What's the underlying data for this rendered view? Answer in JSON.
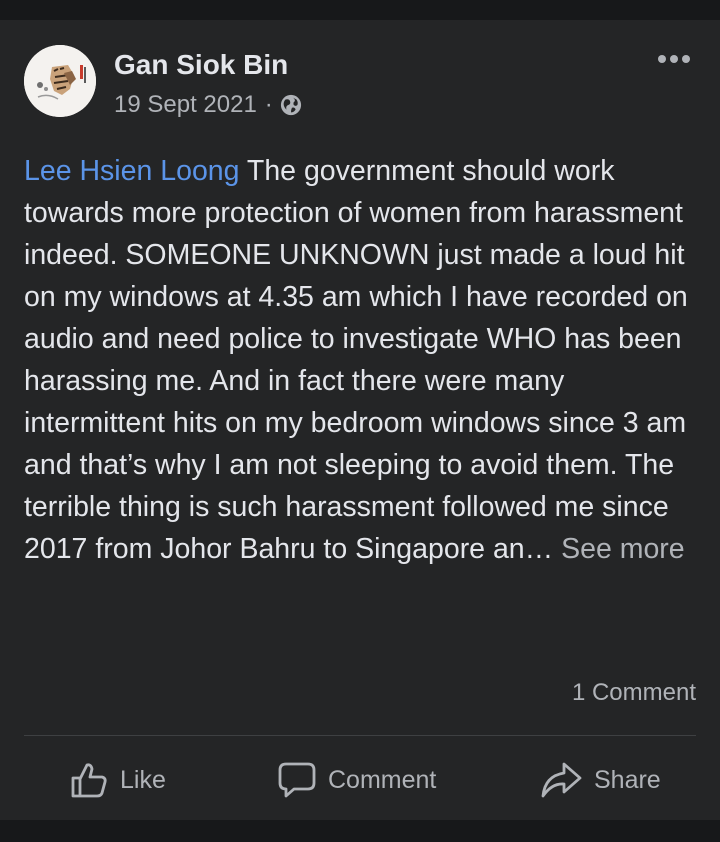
{
  "post": {
    "author": "Gan Siok Bin",
    "date": "19 Sept 2021",
    "separator": "·",
    "privacy_icon": "globe-icon",
    "options_icon": "more-options-icon",
    "mention": "Lee Hsien Loong",
    "body": " The government should work towards more protection of women from harassment indeed. SOMEONE UNKNOWN just made a loud hit on my windows at 4.35 am which I have recorded on audio and need police to investigate WHO has been harassing me. And in fact there were many intermittent hits on my bedroom windows since 3 am and that’s why I am not sleeping to avoid them. The  terrible thing is such harassment followed me since 2017 from Johor Bahru to Singapore an…",
    "see_more": " See more",
    "comment_count": "1 Comment"
  },
  "actions": {
    "like": "Like",
    "comment": "Comment",
    "share": "Share"
  },
  "colors": {
    "background": "#17181a",
    "card": "#242526",
    "primary_text": "#e4e6eb",
    "secondary_text": "#b0b3b8",
    "mention": "#5b94e8"
  }
}
